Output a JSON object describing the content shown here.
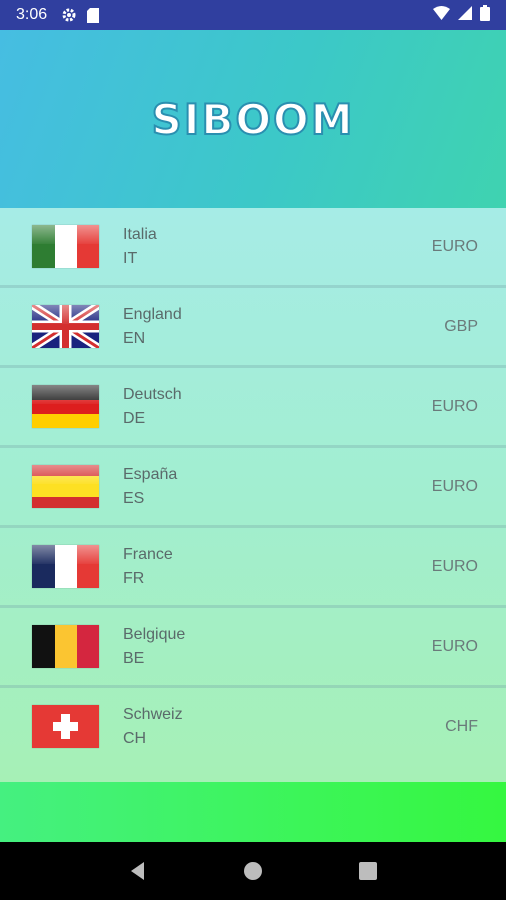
{
  "status_bar": {
    "time": "3:06"
  },
  "header": {
    "logo_text": "SIBOOM"
  },
  "countries": [
    {
      "name": "Italia",
      "code": "IT",
      "currency": "EURO",
      "flag_icon": "italy-flag-icon"
    },
    {
      "name": "England",
      "code": "EN",
      "currency": "GBP",
      "flag_icon": "uk-flag-icon"
    },
    {
      "name": "Deutsch",
      "code": "DE",
      "currency": "EURO",
      "flag_icon": "germany-flag-icon"
    },
    {
      "name": "España",
      "code": "ES",
      "currency": "EURO",
      "flag_icon": "spain-flag-icon"
    },
    {
      "name": "France",
      "code": "FR",
      "currency": "EURO",
      "flag_icon": "france-flag-icon"
    },
    {
      "name": "Belgique",
      "code": "BE",
      "currency": "EURO",
      "flag_icon": "belgium-flag-icon"
    },
    {
      "name": "Schweiz",
      "code": "CH",
      "currency": "CHF",
      "flag_icon": "switzerland-flag-icon"
    }
  ],
  "colors": {
    "status_bar": "#303f9f",
    "italy": [
      "#2e7d32",
      "#ffffff",
      "#e53935"
    ],
    "uk": [
      "#1a237e",
      "#ffffff",
      "#d32f2f"
    ],
    "germany": [
      "#222222",
      "#dd1e1e",
      "#ffce00"
    ],
    "spain": [
      "#d32f2f",
      "#fde023"
    ],
    "france": [
      "#1a2a5e",
      "#ffffff",
      "#e53935"
    ],
    "belgium": [
      "#111111",
      "#fbc531",
      "#d4263f"
    ],
    "switzerland": [
      "#e53935",
      "#ffffff"
    ]
  }
}
